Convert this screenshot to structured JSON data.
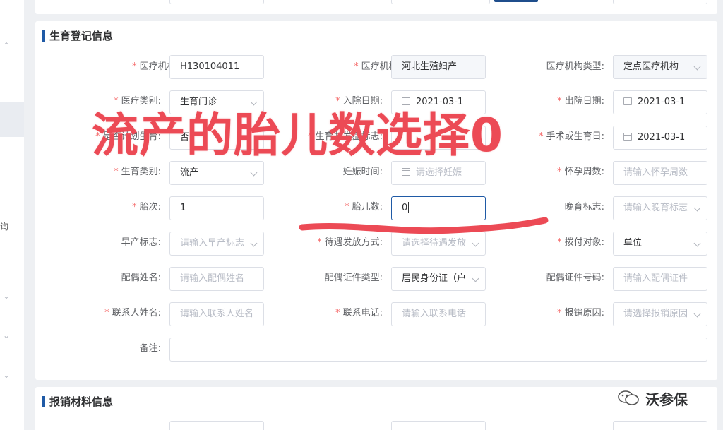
{
  "sidebar": {
    "fragment_text": "询"
  },
  "section1": {
    "title": "生育登记信息",
    "fields": {
      "org_code": {
        "label": "医疗机构编码:",
        "value": "H130104011"
      },
      "org_name": {
        "label": "医疗机构名称:",
        "value": "河北生殖妇产"
      },
      "org_type": {
        "label": "医疗机构类型:",
        "value": "定点医疗机构"
      },
      "med_type": {
        "label": "医疗类别:",
        "value": "生育门诊"
      },
      "admit_date": {
        "label": "入院日期:",
        "value": "2021-03-1"
      },
      "discharge_date": {
        "label": "出院日期:",
        "value": "2021-03-1"
      },
      "plan_birth": {
        "label": "是否计划生育:",
        "value": "否"
      },
      "complication": {
        "label": "生育并发症标志:",
        "value": ""
      },
      "birth_date": {
        "label": "手术或生育日:",
        "value": "2021-03-1"
      },
      "birth_type": {
        "label": "生育类别:",
        "value": "流产"
      },
      "pregnancy_time": {
        "label": "妊娠时间:",
        "placeholder": "请选择妊娠"
      },
      "pregnancy_weeks": {
        "label": "怀孕周数:",
        "placeholder": "请输入怀孕周数"
      },
      "parity": {
        "label": "胎次:",
        "value": "1"
      },
      "fetus_count": {
        "label": "胎儿数:",
        "value": "0"
      },
      "late_birth": {
        "label": "晚育标志:",
        "placeholder": "请输入晚育标志"
      },
      "premature": {
        "label": "早产标志:",
        "placeholder": "请输入早产标志"
      },
      "payment_method": {
        "label": "待遇发放方式:",
        "placeholder": "请选择待遇发放"
      },
      "pay_target": {
        "label": "拨付对象:",
        "value": "单位"
      },
      "spouse_name": {
        "label": "配偶姓名:",
        "placeholder": "请输入配偶姓名"
      },
      "spouse_id_type": {
        "label": "配偶证件类型:",
        "value": "居民身份证（户"
      },
      "spouse_id_no": {
        "label": "配偶证件号码:",
        "placeholder": "请输入配偶证件"
      },
      "contact_name": {
        "label": "联系人姓名:",
        "placeholder": "请输入联系人姓名"
      },
      "contact_phone": {
        "label": "联系电话:",
        "placeholder": "请输入联系电话"
      },
      "reimburse_reason": {
        "label": "报销原因:",
        "placeholder": "请选择报销原因"
      },
      "remarks": {
        "label": "备注:",
        "value": ""
      }
    }
  },
  "section2": {
    "title": "报销材料信息"
  },
  "annotation": {
    "text": "流产的胎儿数选择0",
    "color": "#ec4a55"
  },
  "watermark": {
    "text": "沃参保"
  }
}
